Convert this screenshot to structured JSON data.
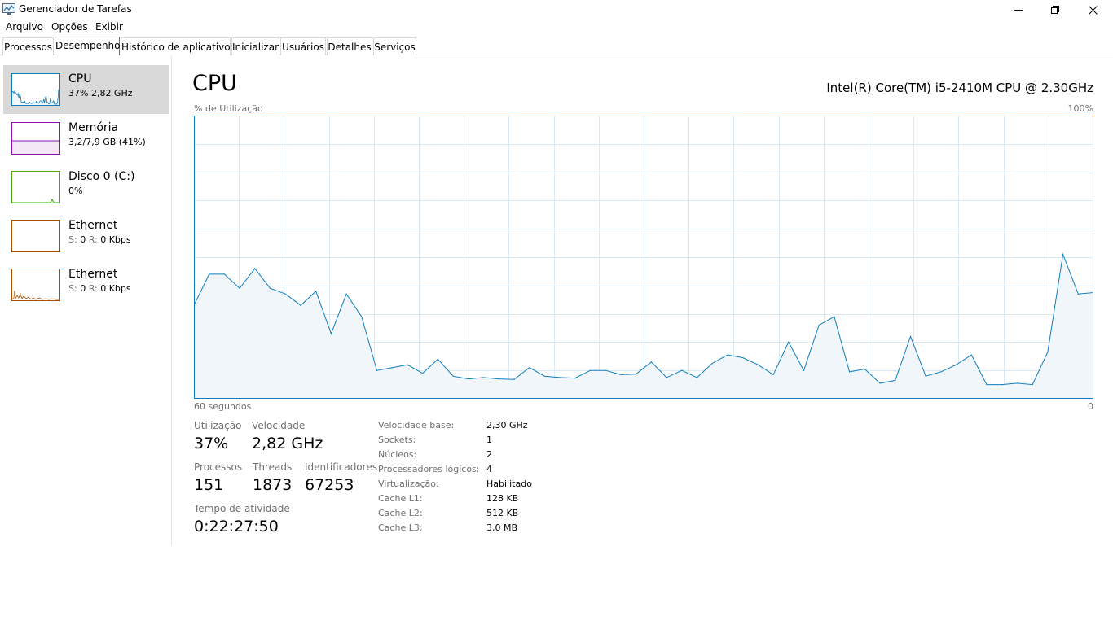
{
  "window": {
    "title": "Gerenciador de Tarefas",
    "icon": "task-manager-icon"
  },
  "menu": [
    "Arquivo",
    "Opções",
    "Exibir"
  ],
  "tabs": [
    {
      "label": "Processos",
      "selected": false
    },
    {
      "label": "Desempenho",
      "selected": true
    },
    {
      "label": "Histórico de aplicativos",
      "selected": false
    },
    {
      "label": "Inicializar",
      "selected": false
    },
    {
      "label": "Usuários",
      "selected": false
    },
    {
      "label": "Detalhes",
      "selected": false
    },
    {
      "label": "Serviços",
      "selected": false
    }
  ],
  "sidebar": {
    "items": [
      {
        "title": "CPU",
        "subtitle": "37% 2,82 GHz",
        "color": "#117dbb",
        "selected": true
      },
      {
        "title": "Memória",
        "subtitle": "3,2/7,9 GB (41%)",
        "color": "#8b12ae",
        "selected": false
      },
      {
        "title": "Disco 0 (C:)",
        "subtitle": "0%",
        "color": "#4da60c",
        "selected": false
      },
      {
        "title": "Ethernet",
        "sub_label_s": "S:",
        "sub_val_s": "0",
        "sub_label_r": "R:",
        "sub_val_r": "0 Kbps",
        "color": "#a74f01",
        "selected": false
      },
      {
        "title": "Ethernet",
        "sub_label_s": "S:",
        "sub_val_s": "0",
        "sub_label_r": "R:",
        "sub_val_r": "0 Kbps",
        "color": "#a74f01",
        "selected": false
      }
    ]
  },
  "main": {
    "title": "CPU",
    "model": "Intel(R) Core(TM) i5-2410M CPU @ 2.30GHz",
    "graph": {
      "ylabel": "% de Utilização",
      "ymax_label": "100%",
      "xlabel_left": "60 segundos",
      "xlabel_right": "0",
      "line_color": "#117dbb",
      "fill_color": "#f1f6fa",
      "grid_color": "#d9eaf4"
    },
    "stats": {
      "utilizacao_label": "Utilização",
      "utilizacao_value": "37%",
      "velocidade_label": "Velocidade",
      "velocidade_value": "2,82 GHz",
      "processos_label": "Processos",
      "processos_value": "151",
      "threads_label": "Threads",
      "threads_value": "1873",
      "identificadores_label": "Identificadores",
      "identificadores_value": "67253",
      "tempo_label": "Tempo de atividade",
      "tempo_value": "0:22:27:50"
    },
    "specs": [
      {
        "label": "Velocidade base:",
        "value": "2,30 GHz"
      },
      {
        "label": "Sockets:",
        "value": "1"
      },
      {
        "label": "Núcleos:",
        "value": "2"
      },
      {
        "label": "Processadores lógicos:",
        "value": "4"
      },
      {
        "label": "Virtualização:",
        "value": "Habilitado"
      },
      {
        "label": "Cache L1:",
        "value": "128 KB"
      },
      {
        "label": "Cache L2:",
        "value": "512 KB"
      },
      {
        "label": "Cache L3:",
        "value": "3,0 MB"
      }
    ]
  },
  "chart_data": {
    "type": "area",
    "ylim": [
      0,
      100
    ],
    "xlim": [
      60,
      0
    ],
    "values": [
      33,
      44,
      44,
      39,
      46,
      39,
      37,
      33,
      38,
      23,
      37,
      29,
      10,
      11,
      12,
      9,
      14,
      8,
      7,
      7.5,
      7,
      6.8,
      11,
      8,
      7.5,
      7.3,
      10,
      10,
      8.5,
      8.7,
      13,
      7.5,
      10,
      7.5,
      12.5,
      15.5,
      14.5,
      12,
      8.5,
      20,
      10,
      26,
      29,
      9.5,
      10.5,
      5.5,
      6.5,
      22,
      8,
      9.5,
      12,
      15.5,
      5,
      5,
      5.5,
      5,
      16.5,
      51,
      37,
      37.5
    ],
    "grid": true
  }
}
